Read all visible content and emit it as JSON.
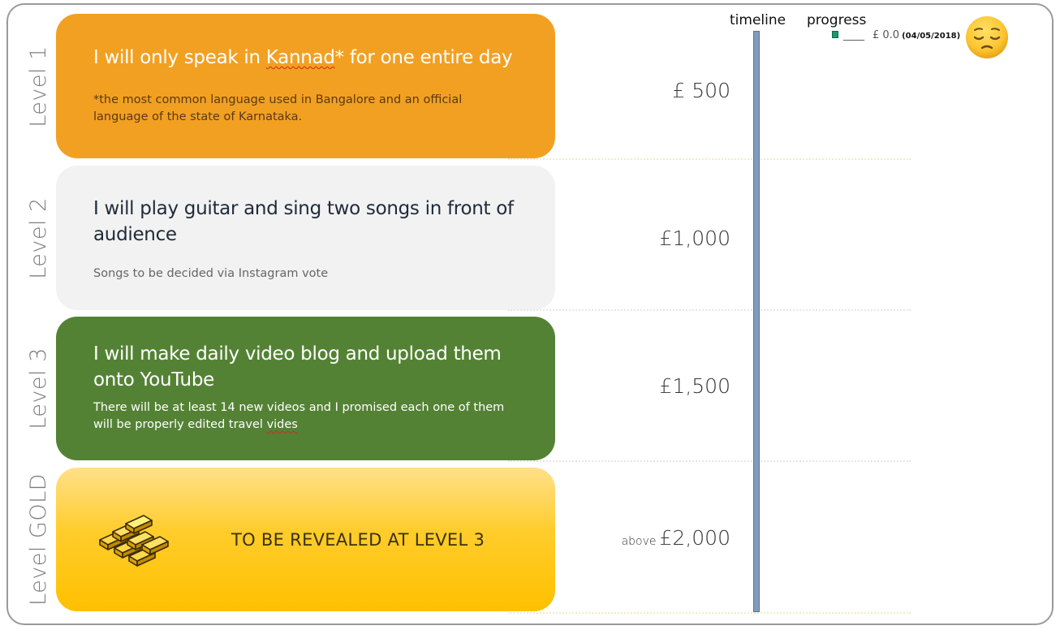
{
  "levels": [
    {
      "label": "Level 1",
      "title_before": "I will only speak in ",
      "title_misspelled": "Kannad",
      "title_after": "* for one entire day",
      "note": "*the most common language used in Bangalore and an official language of the state of Karnataka.",
      "amount": "£ 500",
      "color": "#f2a022"
    },
    {
      "label": "Level 2",
      "title": "I will play guitar and sing two songs in front of audience",
      "note": "Songs to be decided via Instagram vote",
      "amount": "£1,000",
      "color": "#f2f2f2"
    },
    {
      "label": "Level 3",
      "title": "I will make daily video blog and upload them onto YouTube",
      "note_before": "There will be at least 14 new videos and I promised  each one of them will be properly edited travel ",
      "note_misspelled": "vides",
      "amount": "£1,500",
      "color": "#548235"
    },
    {
      "label": "Level GOLD",
      "title": "TO BE REVEALED AT LEVEL 3",
      "amount_prefix": "above",
      "amount": "£2,000",
      "color": "#ffc000",
      "icon": "gold-bars-icon"
    }
  ],
  "timeline": {
    "header": "timeline",
    "color": "#7f9cbf"
  },
  "progress": {
    "header": "progress",
    "dash": "____",
    "amount": "£ 0.0",
    "date": "(04/05/2018)",
    "marker_color": "#1a9a6a",
    "emoji": "pensive-face-icon"
  }
}
